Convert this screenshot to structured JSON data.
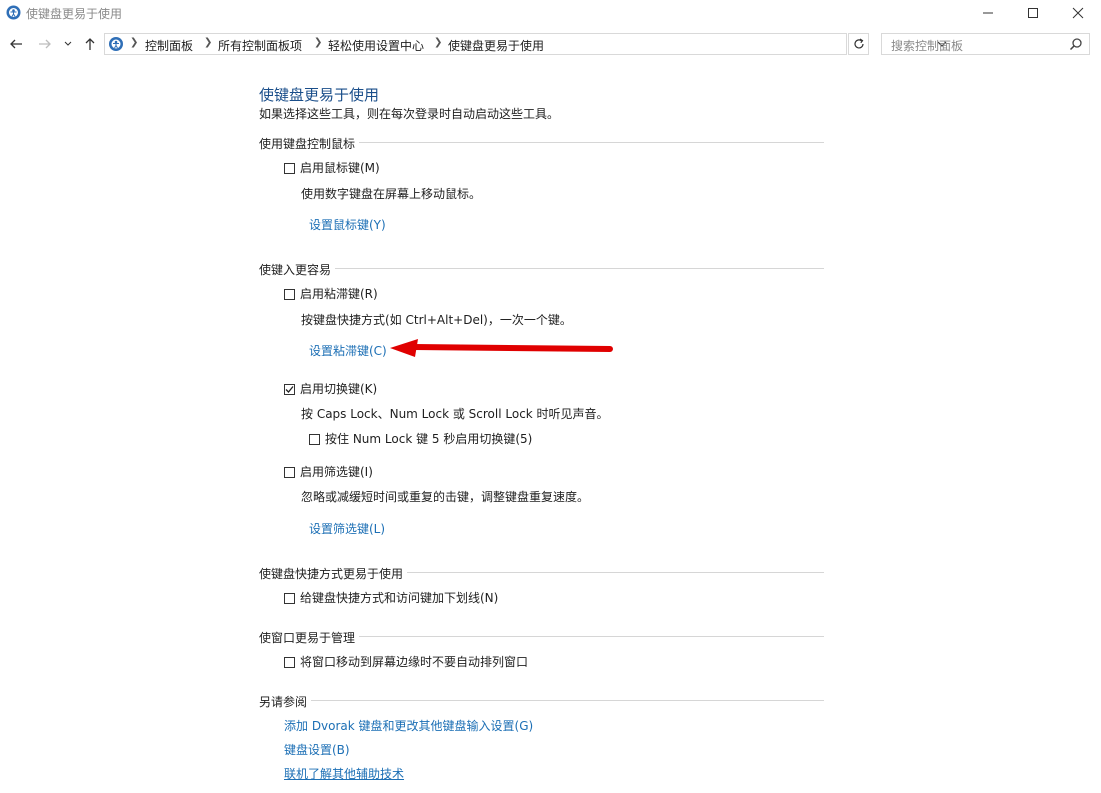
{
  "window": {
    "title": "使键盘更易于使用"
  },
  "address": {
    "breadcrumbs": [
      "控制面板",
      "所有控制面板项",
      "轻松使用设置中心",
      "使键盘更易于使用"
    ]
  },
  "search": {
    "placeholder": "搜索控制面板"
  },
  "page": {
    "title": "使键盘更易于使用",
    "subtitle": "如果选择这些工具，则在每次登录时自动启动这些工具。"
  },
  "sections": {
    "mouse": {
      "header": "使用键盘控制鼠标",
      "mouse_keys": {
        "label": "启用鼠标键(M)",
        "checked": false,
        "desc": "使用数字键盘在屏幕上移动鼠标。",
        "link": "设置鼠标键(Y)"
      }
    },
    "typing": {
      "header": "使键入更容易",
      "sticky_keys": {
        "label": "启用粘滞键(R)",
        "checked": false,
        "desc": "按键盘快捷方式(如 Ctrl+Alt+Del)，一次一个键。",
        "link": "设置粘滞键(C)"
      },
      "toggle_keys": {
        "label": "启用切换键(K)",
        "checked": true,
        "desc": "按 Caps Lock、Num Lock 或 Scroll Lock 时听见声音。",
        "sub_label": "按住 Num Lock 键 5 秒启用切换键(5)",
        "sub_checked": false
      },
      "filter_keys": {
        "label": "启用筛选键(I)",
        "checked": false,
        "desc": "忽略或减缓短时间或重复的击键，调整键盘重复速度。",
        "link": "设置筛选键(L)"
      }
    },
    "shortcuts": {
      "header": "使键盘快捷方式更易于使用",
      "underline": {
        "label": "给键盘快捷方式和访问键加下划线(N)",
        "checked": false
      }
    },
    "windows": {
      "header": "使窗口更易于管理",
      "snap": {
        "label": "将窗口移动到屏幕边缘时不要自动排列窗口",
        "checked": false
      }
    },
    "see_also": {
      "header": "另请参阅",
      "links": [
        "添加 Dvorak 键盘和更改其他键盘输入设置(G)",
        "键盘设置(B)",
        "联机了解其他辅助技术"
      ]
    }
  },
  "colors": {
    "link": "#1c6fb5",
    "title": "#1a4e8a",
    "annotation_arrow": "#e00000"
  },
  "icons": {
    "app": "ease-of-access-icon",
    "back": "arrow-left-icon",
    "forward": "arrow-right-icon",
    "up": "arrow-up-icon",
    "refresh": "refresh-icon",
    "search": "search-icon",
    "annotation": "red-arrow-icon"
  }
}
